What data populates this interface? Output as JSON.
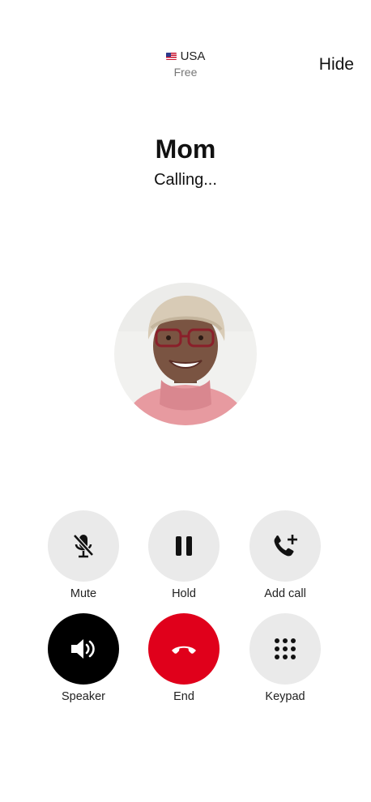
{
  "header": {
    "region": "USA",
    "price": "Free",
    "hide_label": "Hide"
  },
  "call": {
    "contact_name": "Mom",
    "status": "Calling..."
  },
  "controls": {
    "mute_label": "Mute",
    "hold_label": "Hold",
    "add_call_label": "Add call",
    "speaker_label": "Speaker",
    "end_label": "End",
    "keypad_label": "Keypad"
  },
  "colors": {
    "end_button": "#e0001b",
    "speaker_active": "#000000",
    "button_bg": "#eaeaea"
  },
  "icons": {
    "flag": "us-flag-icon",
    "mute": "microphone-off-icon",
    "hold": "pause-icon",
    "add_call": "phone-plus-icon",
    "speaker": "speaker-icon",
    "end": "phone-hangup-icon",
    "keypad": "keypad-icon"
  }
}
